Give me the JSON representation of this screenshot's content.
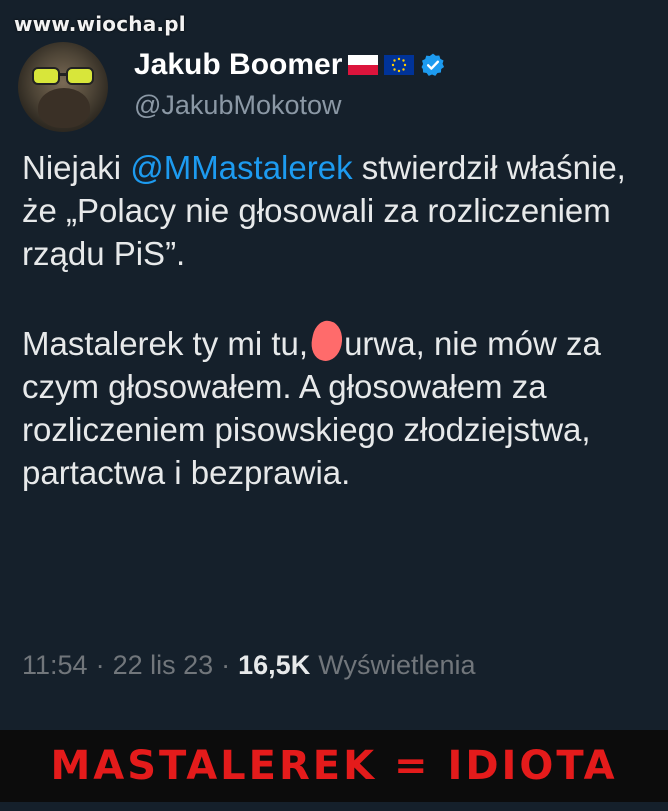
{
  "watermark": "www.wiocha.pl",
  "author": {
    "display_name": "Jakub Boomer",
    "handle": "@JakubMokotow",
    "flags": [
      "poland-flag-icon",
      "eu-flag-icon"
    ],
    "verified_icon": "verified-badge-icon"
  },
  "tweet": {
    "paragraph1_prefix": "Niejaki ",
    "mention": "@MMastalerek",
    "paragraph1_suffix": " stwierdził właśnie, że „Polacy nie głosowali za rozliczeniem rządu PiS”.",
    "paragraph2_prefix": "Mastalerek ty mi tu,",
    "paragraph2_censored_word": "urwa",
    "paragraph2_suffix": ", nie mów za czym głosowałem. A głosowałem za rozliczeniem pisowskiego złodziejstwa, partactwa i bezprawia."
  },
  "meta": {
    "time": "11:54",
    "sep1": "·",
    "date": "22 lis 23",
    "sep2": "·",
    "views_count": "16,5K",
    "views_label": "Wyświetlenia"
  },
  "banner": "MASTALEREK = IDIOTA",
  "colors": {
    "background": "#15202b",
    "mention": "#1d9bf0",
    "banner_text": "#e41b1b"
  }
}
